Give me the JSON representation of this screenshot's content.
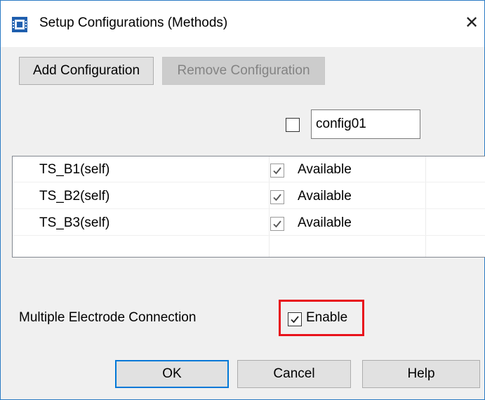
{
  "window": {
    "title": "Setup Configurations (Methods)",
    "close_glyph": "✕",
    "app_icon": "app-chip-icon",
    "accent_color": "#2b7bc4"
  },
  "toolbar": {
    "add_label": "Add Configuration",
    "remove_label": "Remove Configuration",
    "remove_enabled": false
  },
  "config": {
    "checked": false,
    "name": "config01"
  },
  "grid": {
    "rows": [
      {
        "name": "TS_B1(self)",
        "checked": true,
        "status": "Available"
      },
      {
        "name": "TS_B2(self)",
        "checked": true,
        "status": "Available"
      },
      {
        "name": "TS_B3(self)",
        "checked": true,
        "status": "Available"
      }
    ]
  },
  "multi_electrode": {
    "label": "Multiple Electrode Connection",
    "enable_label": "Enable",
    "enabled": true,
    "highlight_color": "#e8121c"
  },
  "footer": {
    "ok_label": "OK",
    "cancel_label": "Cancel",
    "help_label": "Help"
  }
}
